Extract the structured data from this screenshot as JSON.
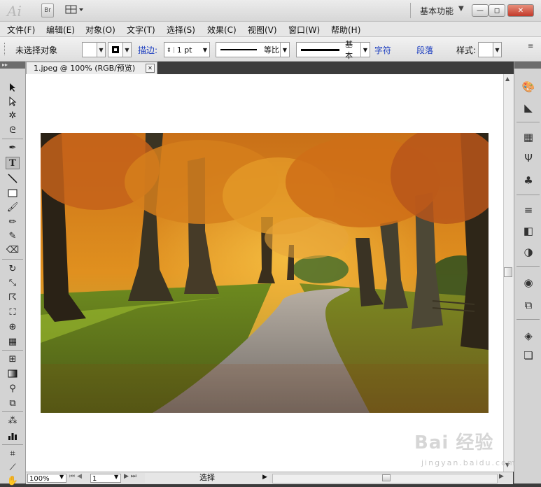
{
  "app": {
    "logo": "Ai",
    "bridge_badge": "Br",
    "workspace": "基本功能"
  },
  "window_controls": {
    "minimize": "—",
    "maximize": "◻",
    "close": "✕"
  },
  "menu": [
    "文件(F)",
    "编辑(E)",
    "对象(O)",
    "文字(T)",
    "选择(S)",
    "效果(C)",
    "视图(V)",
    "窗口(W)",
    "帮助(H)"
  ],
  "control_bar": {
    "selection_status": "未选择对象",
    "stroke_label": "描边:",
    "stroke_weight": "1 pt",
    "profile_label": "等比",
    "brush_label": "基本",
    "char_link": "字符",
    "para_link": "段落",
    "style_label": "样式:"
  },
  "document": {
    "tab_title": "1.jpeg @ 100% (RGB/预览)",
    "close_glyph": "✕"
  },
  "status": {
    "zoom": "100%",
    "artboard": "1",
    "tool_name": "选择"
  },
  "tools": [
    "selection-tool",
    "direct-selection-tool",
    "magic-wand-tool",
    "lasso-tool",
    "pen-tool",
    "type-tool",
    "line-tool",
    "rectangle-tool",
    "paintbrush-tool",
    "pencil-tool",
    "blob-brush-tool",
    "eraser-tool",
    "rotate-tool",
    "scale-tool",
    "warp-tool",
    "free-transform-tool",
    "shape-builder-tool",
    "perspective-grid-tool",
    "mesh-tool",
    "gradient-tool",
    "eyedropper-tool",
    "blend-tool",
    "symbol-sprayer-tool",
    "column-graph-tool",
    "artboard-tool",
    "slice-tool",
    "hand-tool"
  ],
  "tool_glyphs": {
    "active": "T"
  },
  "dock_icons": [
    "color-icon",
    "color-guide-icon",
    "swatches-icon",
    "brushes-icon",
    "symbols-icon",
    "stroke-icon",
    "gradient-icon",
    "transparency-icon",
    "appearance-icon",
    "graphic-styles-icon",
    "layers-icon",
    "artboards-icon"
  ],
  "watermark": {
    "brand": "Bai 经验",
    "url": "jingyan.baidu.com"
  },
  "colors": {
    "accent_link": "#1a3cbf",
    "panel_bg": "#d3d3d3",
    "chrome_dark": "#6c6c6c"
  }
}
